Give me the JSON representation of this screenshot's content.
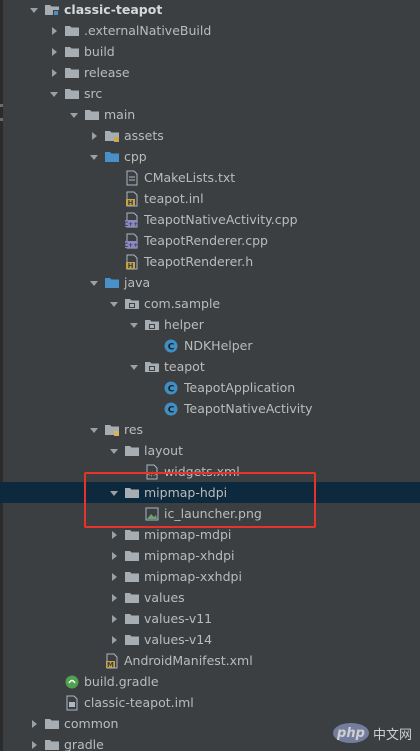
{
  "colors": {
    "background": "#3c3f41",
    "text": "#bbbbbb",
    "selected_row": "#0d293e",
    "highlight_border": "#e8332a",
    "folder": "#a6adb3",
    "source_folder": "#4a90c8",
    "java_class": "#3f8fc4",
    "h_file": "#c7a347",
    "cpp_file": "#8f86c6",
    "gradle": "#4fa04f"
  },
  "tree": {
    "items": [
      {
        "label": "classic-teapot",
        "depth": 0,
        "arrow": "open",
        "icon": "module-folder-icon",
        "bold": true
      },
      {
        "label": ".externalNativeBuild",
        "depth": 1,
        "arrow": "closed",
        "icon": "folder-icon"
      },
      {
        "label": "build",
        "depth": 1,
        "arrow": "closed",
        "icon": "folder-icon"
      },
      {
        "label": "release",
        "depth": 1,
        "arrow": "closed",
        "icon": "folder-icon"
      },
      {
        "label": "src",
        "depth": 1,
        "arrow": "open",
        "icon": "folder-icon"
      },
      {
        "label": "main",
        "depth": 2,
        "arrow": "open",
        "icon": "folder-icon"
      },
      {
        "label": "assets",
        "depth": 3,
        "arrow": "closed",
        "icon": "assets-folder-icon"
      },
      {
        "label": "cpp",
        "depth": 3,
        "arrow": "open",
        "icon": "source-folder-icon"
      },
      {
        "label": "CMakeLists.txt",
        "depth": 4,
        "arrow": "none",
        "icon": "text-file-icon"
      },
      {
        "label": "teapot.inl",
        "depth": 4,
        "arrow": "none",
        "icon": "h-file-icon"
      },
      {
        "label": "TeapotNativeActivity.cpp",
        "depth": 4,
        "arrow": "none",
        "icon": "cpp-file-icon"
      },
      {
        "label": "TeapotRenderer.cpp",
        "depth": 4,
        "arrow": "none",
        "icon": "cpp-file-icon"
      },
      {
        "label": "TeapotRenderer.h",
        "depth": 4,
        "arrow": "none",
        "icon": "h-file-icon"
      },
      {
        "label": "java",
        "depth": 3,
        "arrow": "open",
        "icon": "source-folder-icon"
      },
      {
        "label": "com.sample",
        "depth": 4,
        "arrow": "open",
        "icon": "package-icon"
      },
      {
        "label": "helper",
        "depth": 5,
        "arrow": "open",
        "icon": "package-icon"
      },
      {
        "label": "NDKHelper",
        "depth": 6,
        "arrow": "none",
        "icon": "java-class-icon"
      },
      {
        "label": "teapot",
        "depth": 5,
        "arrow": "open",
        "icon": "package-icon"
      },
      {
        "label": "TeapotApplication",
        "depth": 6,
        "arrow": "none",
        "icon": "java-class-icon"
      },
      {
        "label": "TeapotNativeActivity",
        "depth": 6,
        "arrow": "none",
        "icon": "java-class-icon"
      },
      {
        "label": "res",
        "depth": 3,
        "arrow": "open",
        "icon": "res-folder-icon"
      },
      {
        "label": "layout",
        "depth": 4,
        "arrow": "open",
        "icon": "folder-icon"
      },
      {
        "label": "widgets.xml",
        "depth": 5,
        "arrow": "none",
        "icon": "xml-file-icon"
      },
      {
        "label": "mipmap-hdpi",
        "depth": 4,
        "arrow": "open",
        "icon": "folder-icon",
        "selected": true
      },
      {
        "label": "ic_launcher.png",
        "depth": 5,
        "arrow": "none",
        "icon": "image-file-icon"
      },
      {
        "label": "mipmap-mdpi",
        "depth": 4,
        "arrow": "closed",
        "icon": "folder-icon"
      },
      {
        "label": "mipmap-xhdpi",
        "depth": 4,
        "arrow": "closed",
        "icon": "folder-icon"
      },
      {
        "label": "mipmap-xxhdpi",
        "depth": 4,
        "arrow": "closed",
        "icon": "folder-icon"
      },
      {
        "label": "values",
        "depth": 4,
        "arrow": "closed",
        "icon": "folder-icon"
      },
      {
        "label": "values-v11",
        "depth": 4,
        "arrow": "closed",
        "icon": "folder-icon"
      },
      {
        "label": "values-v14",
        "depth": 4,
        "arrow": "closed",
        "icon": "folder-icon"
      },
      {
        "label": "AndroidManifest.xml",
        "depth": 3,
        "arrow": "none",
        "icon": "manifest-file-icon"
      },
      {
        "label": "build.gradle",
        "depth": 1,
        "arrow": "none",
        "icon": "gradle-file-icon"
      },
      {
        "label": "classic-teapot.iml",
        "depth": 1,
        "arrow": "none",
        "icon": "iml-file-icon"
      },
      {
        "label": "common",
        "depth": 0,
        "arrow": "closed",
        "icon": "folder-icon"
      },
      {
        "label": "gradle",
        "depth": 0,
        "arrow": "closed",
        "icon": "folder-icon"
      }
    ]
  },
  "watermark": {
    "logo": "php",
    "text": "中文网"
  }
}
